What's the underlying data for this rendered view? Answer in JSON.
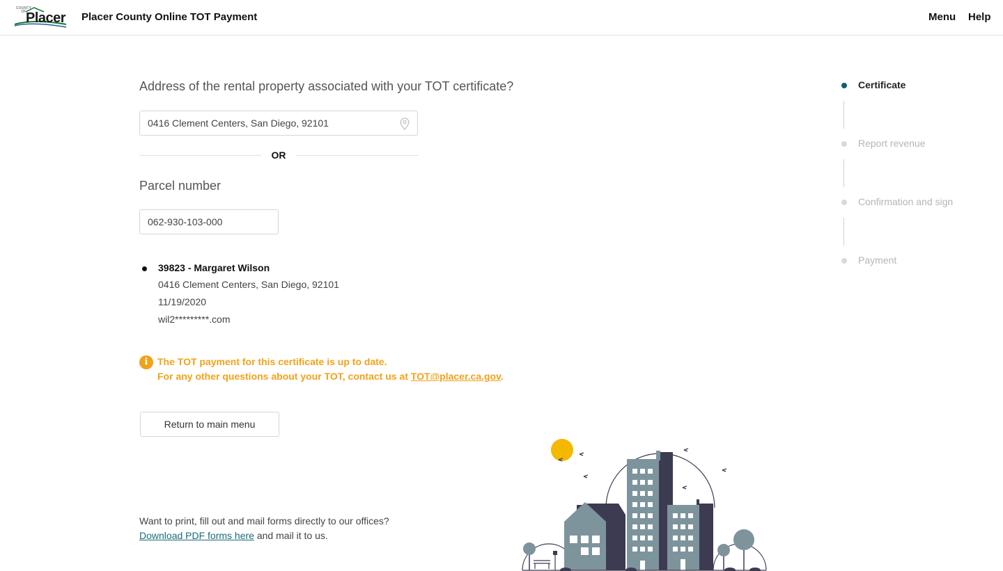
{
  "header": {
    "logo_small": "COUNTY OF",
    "logo_word": "Placer",
    "app_title": "Placer County Online TOT Payment",
    "nav_menu": "Menu",
    "nav_help": "Help"
  },
  "form": {
    "address_question": "Address of the rental property associated with your TOT certificate?",
    "address_value": "0416 Clement Centers, San Diego, 92101",
    "or_label": "OR",
    "parcel_label": "Parcel number",
    "parcel_value": "062-930-103-000"
  },
  "result": {
    "title": "39823 - Margaret Wilson",
    "address": "0416 Clement Centers, San Diego, 92101",
    "date": "11/19/2020",
    "email": "wil2*********.com"
  },
  "notice": {
    "icon": "i",
    "line1": "The TOT payment for this certificate is up to date.",
    "line2_prefix": "For any other questions about your TOT, contact us at ",
    "line2_link": "TOT@placer.ca.gov",
    "line2_suffix": "."
  },
  "actions": {
    "return_label": "Return to main menu"
  },
  "footer": {
    "line1": "Want to print, fill out and mail forms directly to our offices?",
    "link_text": "Download PDF forms here",
    "line2_suffix": " and mail it to us."
  },
  "stepper": {
    "steps": [
      {
        "label": "Certificate",
        "active": true
      },
      {
        "label": "Report revenue",
        "active": false
      },
      {
        "label": "Confirmation and sign",
        "active": false
      },
      {
        "label": "Payment",
        "active": false
      }
    ]
  },
  "colors": {
    "accent": "#0f5f6b",
    "warning": "#f0a21b",
    "link": "#1b6b7a"
  },
  "icons": {
    "address_field": "map-pin-icon",
    "notice": "info-icon"
  }
}
